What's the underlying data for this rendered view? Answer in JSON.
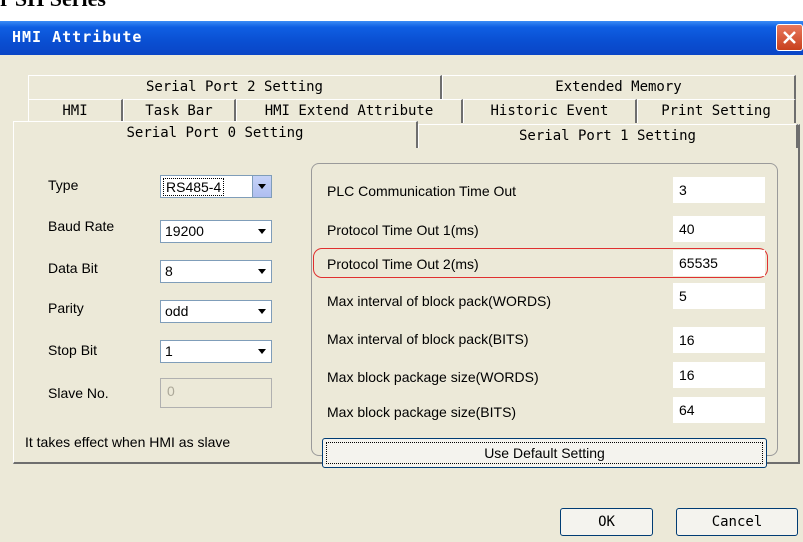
{
  "page_fragment": "r SH Series",
  "window": {
    "title": "HMI Attribute"
  },
  "tabs": {
    "row1": [
      "Serial Port 2 Setting",
      "Extended Memory"
    ],
    "row2": [
      "HMI",
      "Task Bar",
      "HMI Extend Attribute",
      "Historic Event",
      "Print Setting"
    ],
    "row3": [
      "Serial Port 0 Setting",
      "Serial Port 1 Setting"
    ],
    "active": "Serial Port 0 Setting"
  },
  "settings": {
    "type": {
      "label": "Type",
      "value": "RS485-4"
    },
    "baud_rate": {
      "label": "Baud Rate",
      "value": "19200"
    },
    "data_bit": {
      "label": "Data Bit",
      "value": "8"
    },
    "parity": {
      "label": "Parity",
      "value": "odd"
    },
    "stop_bit": {
      "label": "Stop Bit",
      "value": "1"
    },
    "slave_no": {
      "label": "Slave No.",
      "value": "0"
    },
    "note": "It takes effect when HMI as slave"
  },
  "params": [
    {
      "label": "PLC Communication Time Out",
      "value": "3"
    },
    {
      "label": "Protocol Time Out 1(ms)",
      "value": "40"
    },
    {
      "label": "Protocol Time Out 2(ms)",
      "value": "65535",
      "highlighted": true
    },
    {
      "label": "Max interval of block pack(WORDS)",
      "value": "5"
    },
    {
      "label": "Max interval of block pack(BITS)",
      "value": "16"
    },
    {
      "label": "Max block package size(WORDS)",
      "value": "16"
    },
    {
      "label": "Max block package size(BITS)",
      "value": "64"
    }
  ],
  "buttons": {
    "default": "Use Default Setting",
    "ok": "OK",
    "cancel": "Cancel"
  },
  "colors": {
    "titlebar": "#0a4fd2",
    "dialog_bg": "#ece9d8",
    "highlight": "#e03030",
    "close": "#c8401d"
  },
  "icons": {
    "close": "close-icon",
    "dropdown": "chevron-down-icon"
  }
}
